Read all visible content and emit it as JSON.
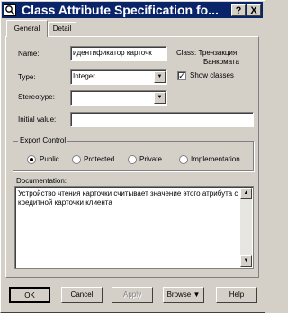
{
  "window": {
    "title": "Class Attribute Specification fo...",
    "help_button": "?",
    "close_button": "X"
  },
  "tabs": [
    {
      "label": "General",
      "active": true
    },
    {
      "label": "Detail",
      "active": false
    }
  ],
  "form": {
    "name_label": "Name:",
    "name_value": "идентификатор карточк",
    "class_label": "Class: Трензакция",
    "class_value": "Банкомата",
    "type_label": "Type:",
    "type_value": "Integer",
    "show_classes_label": "Show classes",
    "show_classes_checked": true,
    "stereotype_label": "Stereotype:",
    "stereotype_value": "",
    "initial_value_label": "Initial value:",
    "initial_value_value": ""
  },
  "export_control": {
    "title": "Export Control",
    "options": [
      "Public",
      "Protected",
      "Private",
      "Implementation"
    ],
    "selected": "Public"
  },
  "documentation": {
    "label": "Documentation:",
    "text": "Устройство чтения карточки считывает значение этого атрибута с кредитной карточки клиента"
  },
  "buttons": {
    "ok": "OK",
    "cancel": "Cancel",
    "apply": "Apply",
    "browse": "Browse ▼",
    "help": "Help"
  },
  "icons": {
    "title": "magnifier-icon",
    "dropdown": "down-arrow-icon",
    "scroll_up": "up-arrow-icon",
    "scroll_down": "down-arrow-icon"
  }
}
